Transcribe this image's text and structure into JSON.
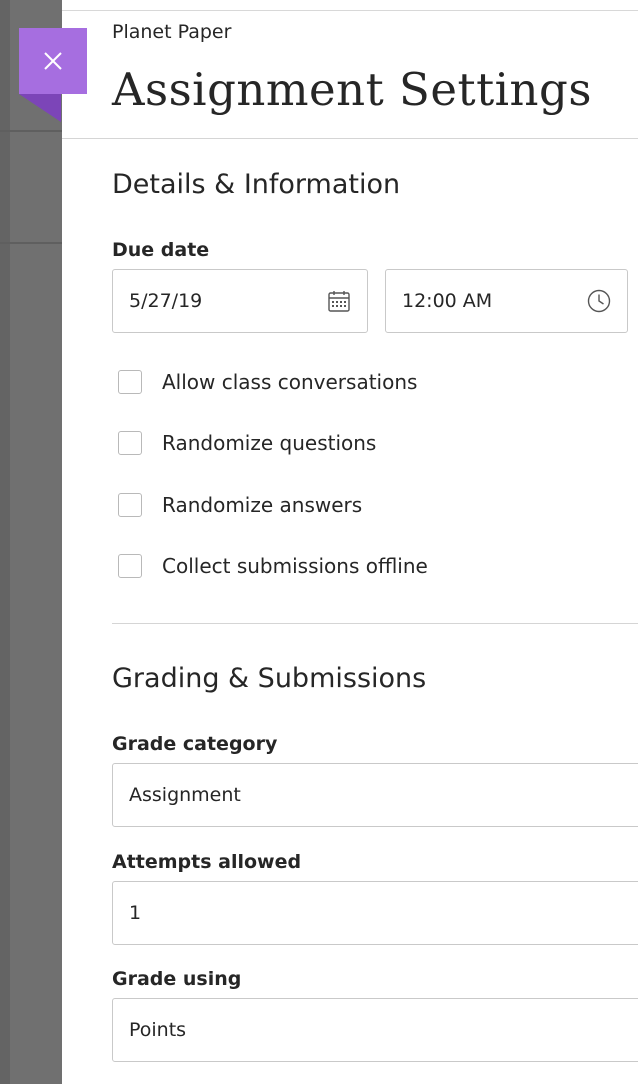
{
  "panel": {
    "course_name": "Planet Paper",
    "title": "Assignment Settings",
    "close_icon": "close-icon"
  },
  "details": {
    "heading": "Details & Information",
    "due_date_label": "Due date",
    "due_date_value": "5/27/19",
    "due_time_value": "12:00 AM",
    "date_icon": "calendar-icon",
    "time_icon": "clock-icon",
    "checkboxes": [
      {
        "label": "Allow class conversations",
        "checked": false
      },
      {
        "label": "Randomize questions",
        "checked": false
      },
      {
        "label": "Randomize answers",
        "checked": false
      },
      {
        "label": "Collect submissions offline",
        "checked": false
      }
    ]
  },
  "grading": {
    "heading": "Grading & Submissions",
    "grade_category_label": "Grade category",
    "grade_category_value": "Assignment",
    "attempts_label": "Attempts allowed",
    "attempts_value": "1",
    "grade_using_label": "Grade using",
    "grade_using_value": "Points"
  },
  "colors": {
    "accent": "#a66ee0",
    "accent_dark": "#7c45b8",
    "backdrop": "#707070",
    "text": "#262626"
  }
}
